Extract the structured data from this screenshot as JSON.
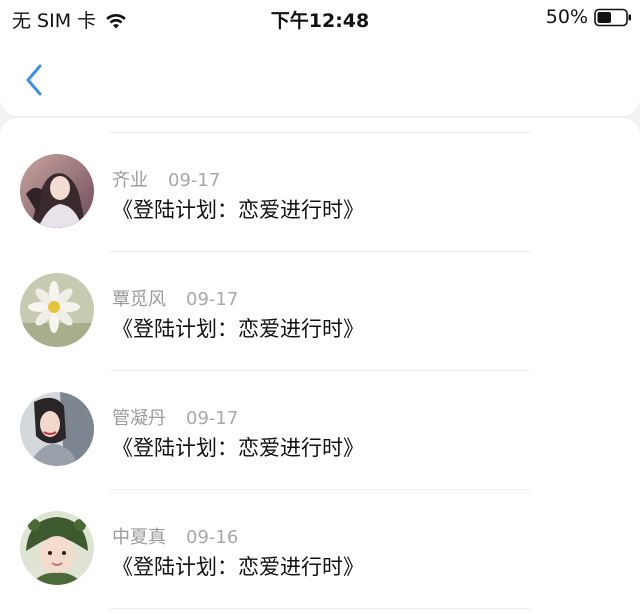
{
  "status_bar": {
    "carrier": "无 SIM 卡",
    "time": "下午12:48",
    "battery": "50%",
    "battery_level": 0.5
  },
  "nav": {
    "back_icon": "chevron-left-icon",
    "accent_color": "#3a8ef6"
  },
  "comments": [
    {
      "name": "齐业",
      "date": "09-17",
      "title": "《登陆计划：恋爱进行时》",
      "avatar": "anime-girl-avatar"
    },
    {
      "name": "覃觅风",
      "date": "09-17",
      "title": "《登陆计划：恋爱进行时》",
      "avatar": "daisy-flower-avatar"
    },
    {
      "name": "管凝丹",
      "date": "09-17",
      "title": "《登陆计划：恋爱进行时》",
      "avatar": "woman-portrait-avatar"
    },
    {
      "name": "中夏真",
      "date": "09-16",
      "title": "《登陆计划：恋爱进行时》",
      "avatar": "child-hat-avatar"
    }
  ]
}
